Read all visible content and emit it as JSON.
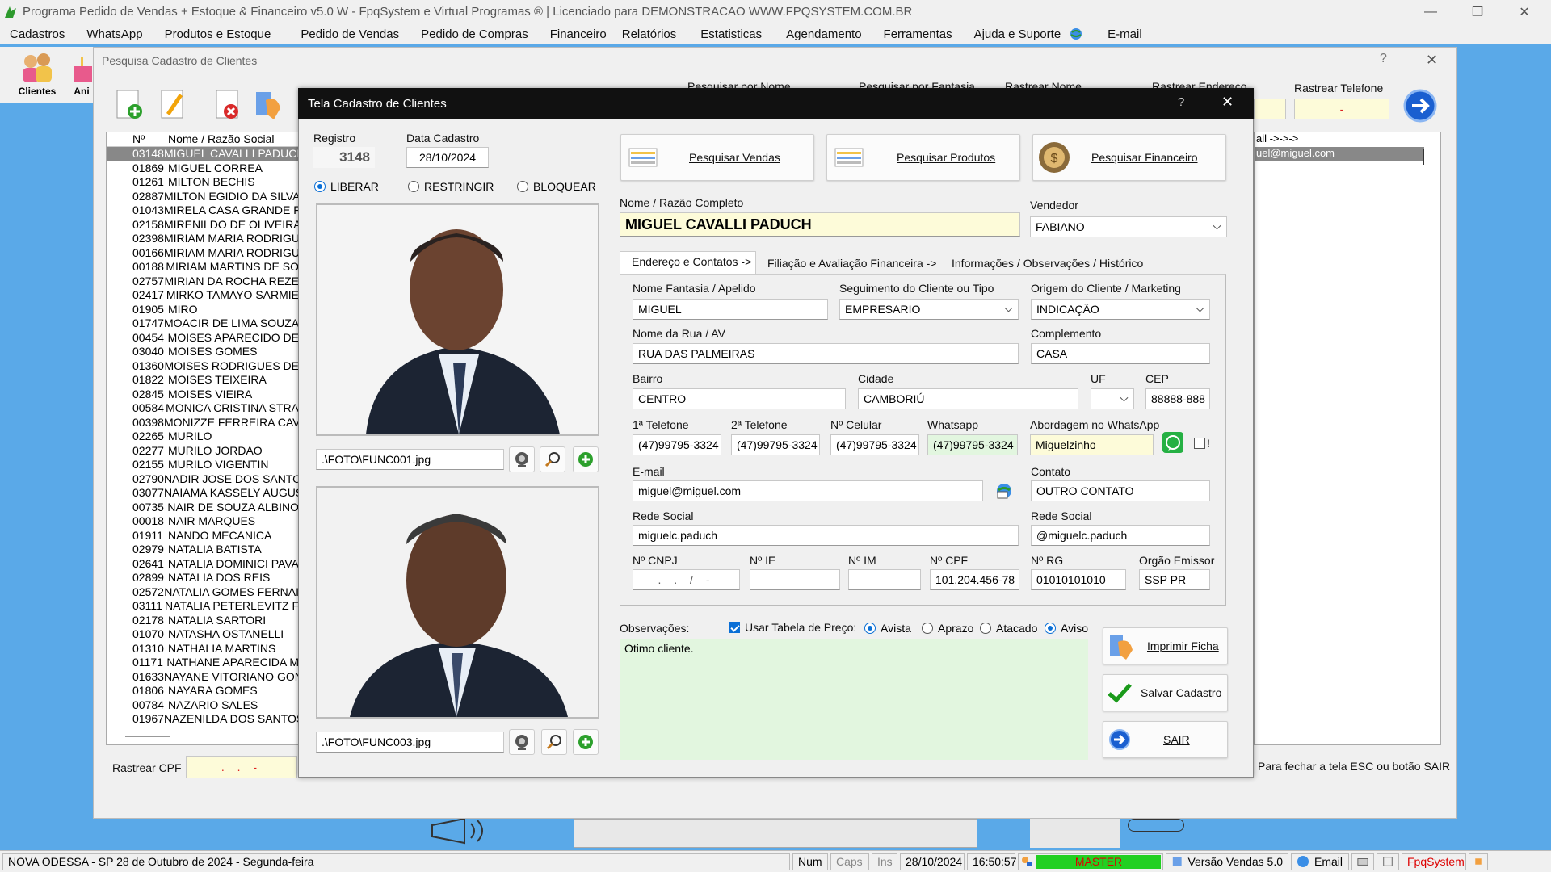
{
  "app": {
    "title": "Programa Pedido de Vendas + Estoque & Financeiro v5.0 W - FpqSystem e Virtual Programas ® | Licenciado para  DEMONSTRACAO WWW.FPQSYSTEM.COM.BR",
    "menu": [
      "Cadastros",
      "WhatsApp",
      "Produtos e Estoque",
      "Pedido de Vendas",
      "Pedido de Compras",
      "Financeiro",
      "Relatórios",
      "Estatisticas",
      "Agendamento",
      "Ferramentas",
      "Ajuda e Suporte",
      "E-mail"
    ]
  },
  "toolbar": {
    "clientes_label": "Clientes",
    "ani_label": "Ani"
  },
  "search_window": {
    "title": "Pesquisa Cadastro de Clientes",
    "col_num": "Nº",
    "col_name": "Nome / Razão Social",
    "header_labels": [
      "Pesquisar por Nome",
      "Pesquisar por Fantasia",
      "Rastrear Nome",
      "Rastrear Endereco"
    ],
    "rastrear_telefone_label": "Rastrear Telefone",
    "rastrear_telefone_value": "-",
    "email_col_header": "ail ->->->",
    "email_col_value": "uel@miguel.com",
    "rastrear_cpf_label": "Rastrear CPF",
    "rastrear_cpf_value": ". . -",
    "close_hint": "Para fechar a tela ESC ou botão SAIR",
    "rows": [
      [
        "03148",
        "MIGUEL CAVALLI PADUCH"
      ],
      [
        "01869",
        "MIGUEL CORREA"
      ],
      [
        "01261",
        "MILTON BECHIS"
      ],
      [
        "02887",
        "MILTON EGIDIO DA SILVA"
      ],
      [
        "01043",
        "MIRELA CASA GRANDE F"
      ],
      [
        "02158",
        "MIRENILDO DE OLIVEIRA"
      ],
      [
        "02398",
        "MIRIAM MARIA RODRIGU"
      ],
      [
        "00166",
        "MIRIAM MARIA RODRIGU"
      ],
      [
        "00188",
        "MIRIAM MARTINS DE SO"
      ],
      [
        "02757",
        "MIRIAN DA ROCHA REZE"
      ],
      [
        "02417",
        "MIRKO TAMAYO SARMIE"
      ],
      [
        "01905",
        "MIRO"
      ],
      [
        "01747",
        "MOACIR DE LIMA SOUZA"
      ],
      [
        "00454",
        "MOISES APARECIDO DE"
      ],
      [
        "03040",
        "MOISES GOMES"
      ],
      [
        "01360",
        "MOISES RODRIGUES DE"
      ],
      [
        "01822",
        "MOISES TEIXEIRA"
      ],
      [
        "02845",
        "MOISES VIEIRA"
      ],
      [
        "00584",
        "MONICA CRISTINA STRA"
      ],
      [
        "00398",
        "MONIZZE FERREIRA CAV"
      ],
      [
        "02265",
        "MURILO"
      ],
      [
        "02277",
        "MURILO JORDAO"
      ],
      [
        "02155",
        "MURILO VIGENTIN"
      ],
      [
        "02790",
        "NADIR JOSE DOS SANTO"
      ],
      [
        "03077",
        "NAIAMA KASSELY AUGUS"
      ],
      [
        "00735",
        "NAIR DE SOUZA ALBINO"
      ],
      [
        "00018",
        "NAIR MARQUES"
      ],
      [
        "01911",
        "NANDO MECANICA"
      ],
      [
        "02979",
        "NATALIA  BATISTA"
      ],
      [
        "02641",
        "NATALIA DOMINICI PAVA"
      ],
      [
        "02899",
        "NATALIA DOS REIS"
      ],
      [
        "02572",
        "NATALIA GOMES FERNAI"
      ],
      [
        "03111",
        "NATALIA PETERLEVITZ F"
      ],
      [
        "02178",
        "NATALIA SARTORI"
      ],
      [
        "01070",
        "NATASHA OSTANELLI"
      ],
      [
        "01310",
        "NATHALIA MARTINS"
      ],
      [
        "01171",
        "NATHANE APARECIDA M"
      ],
      [
        "01633",
        "NAYANE VITORIANO GON"
      ],
      [
        "01806",
        "NAYARA GOMES"
      ],
      [
        "00784",
        "NAZARIO SALES"
      ],
      [
        "01967",
        "NAZENILDA DOS SANTOS"
      ]
    ]
  },
  "dialog": {
    "title": "Tela Cadastro de Clientes",
    "help": "?",
    "registro_label": "Registro",
    "registro_value": "3148",
    "data_cadastro_label": "Data Cadastro",
    "data_cadastro_value": "28/10/2024",
    "status_options": [
      "LIBERAR",
      "RESTRINGIR",
      "BLOQUEAR"
    ],
    "status_selected": "LIBERAR",
    "photo1_path": ".\\FOTO\\FUNC001.jpg",
    "photo2_path": ".\\FOTO\\FUNC003.jpg",
    "btn_pesquisar_vendas": "Pesquisar Vendas",
    "btn_pesquisar_produtos": "Pesquisar Produtos",
    "btn_pesquisar_financeiro": "Pesquisar  Financeiro",
    "nome_label": "Nome / Razão Completo",
    "nome_value": "MIGUEL CAVALLI PADUCH",
    "vendedor_label": "Vendedor",
    "vendedor_value": "FABIANO",
    "tabs": [
      "Endereço e Contatos ->",
      "Filiação e Avaliação Financeira ->",
      "Informações / Observações / Histórico"
    ],
    "fantasia_label": "Nome Fantasia / Apelido",
    "fantasia_value": "MIGUEL",
    "seguimento_label": "Seguimento do Cliente ou Tipo",
    "seguimento_value": "EMPRESARIO",
    "origem_label": "Origem do Cliente / Marketing",
    "origem_value": "INDICAÇÃO",
    "rua_label": "Nome da Rua / AV",
    "rua_value": "RUA DAS PALMEIRAS",
    "complemento_label": "Complemento",
    "complemento_value": "CASA",
    "bairro_label": "Bairro",
    "bairro_value": "CENTRO",
    "cidade_label": "Cidade",
    "cidade_value": "CAMBORIÚ",
    "uf_label": "UF",
    "uf_value": "",
    "cep_label": "CEP",
    "cep_value": "88888-888",
    "tel1_label": "1ª Telefone",
    "tel1_value": "(47)99795-3324",
    "tel2_label": "2ª Telefone",
    "tel2_value": "(47)99795-3324",
    "celular_label": "Nº Celular",
    "celular_value": "(47)99795-3324",
    "whatsapp_label": "Whatsapp",
    "whatsapp_value": "(47)99795-3324",
    "abordagem_label": "Abordagem no WhatsApp",
    "abordagem_value": "Miguelzinho",
    "abordagem_check_suffix": "!",
    "email_label": "E-mail",
    "email_value": "miguel@miguel.com",
    "contato_label": "Contato",
    "contato_value": "OUTRO CONTATO",
    "rede1_label": "Rede Social",
    "rede1_value": "miguelc.paduch",
    "rede2_label": "Rede Social",
    "rede2_value": "@miguelc.paduch",
    "cnpj_label": "Nº CNPJ",
    "cnpj_value": ". . / -",
    "ie_label": "Nº IE",
    "ie_value": "",
    "im_label": "Nº IM",
    "im_value": "",
    "cpf_label": "Nº CPF",
    "cpf_value": "101.204.456-78",
    "rg_label": "Nº RG",
    "rg_value": "01010101010",
    "orgao_label": "Orgão Emissor",
    "orgao_value": "SSP PR",
    "obs_label": "Observações:",
    "usar_tabela_label": "Usar Tabela de Preço:",
    "price_options": [
      "Avista",
      "Aprazo",
      "Atacado",
      "Aviso"
    ],
    "obs_value": "Otimo cliente.",
    "btn_imprimir": "Imprimir Ficha",
    "btn_salvar": "Salvar Cadastro",
    "btn_sair": "SAIR"
  },
  "statusbar": {
    "location": "NOVA ODESSA - SP 28 de Outubro de 2024 - Segunda-feira",
    "num": "Num",
    "caps": "Caps",
    "ins": "Ins",
    "date": "28/10/2024",
    "time": "16:50:57",
    "user": "MASTER",
    "version": "Versão Vendas 5.0",
    "email": "Email",
    "brand": "FpqSystem"
  },
  "colors": {
    "accent": "#0a6fd6",
    "master_bg": "#22d022",
    "yellow_field": "#fdfbd9",
    "green_field": "#e2f6df",
    "desktop": "#5aa9e8"
  }
}
